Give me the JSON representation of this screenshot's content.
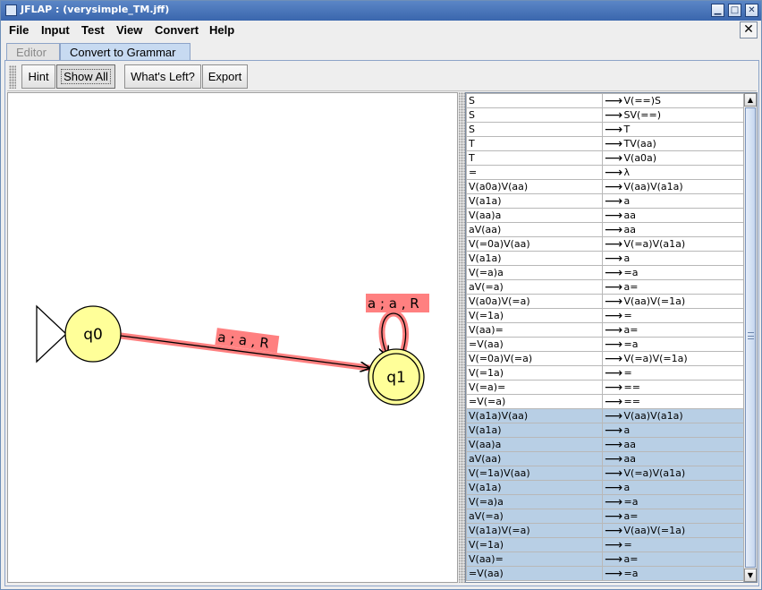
{
  "window": {
    "title": "JFLAP : (verysimple_TM.jff)"
  },
  "menu": [
    "File",
    "Input",
    "Test",
    "View",
    "Convert",
    "Help"
  ],
  "tabs": {
    "editor": "Editor",
    "convert": "Convert to Grammar"
  },
  "toolbar": {
    "hint": "Hint",
    "show_all": "Show All",
    "whats_left": "What's Left?",
    "export": "Export"
  },
  "automaton": {
    "states": [
      {
        "name": "q0",
        "initial": true,
        "final": false
      },
      {
        "name": "q1",
        "initial": false,
        "final": true
      }
    ],
    "transitions": [
      {
        "from": "q0",
        "to": "q1",
        "label": "a ; a , R"
      },
      {
        "from": "q1",
        "to": "q1",
        "label": "a ; a , R"
      }
    ],
    "state_fill": "#ffff99",
    "highlight_color": "#ff8080"
  },
  "grammar": {
    "arrow": "⟶",
    "selected_color": "#b8cfe5",
    "productions": [
      {
        "lhs": "S",
        "rhs": "V(==)S",
        "selected": false
      },
      {
        "lhs": "S",
        "rhs": "SV(==)",
        "selected": false
      },
      {
        "lhs": "S",
        "rhs": "T",
        "selected": false
      },
      {
        "lhs": "T",
        "rhs": "TV(aa)",
        "selected": false
      },
      {
        "lhs": "T",
        "rhs": "V(a0a)",
        "selected": false
      },
      {
        "lhs": "=",
        "rhs": "λ",
        "selected": false
      },
      {
        "lhs": "V(a0a)V(aa)",
        "rhs": "V(aa)V(a1a)",
        "selected": false
      },
      {
        "lhs": "V(a1a)",
        "rhs": "a",
        "selected": false
      },
      {
        "lhs": "V(aa)a",
        "rhs": "aa",
        "selected": false
      },
      {
        "lhs": "aV(aa)",
        "rhs": "aa",
        "selected": false
      },
      {
        "lhs": "V(=0a)V(aa)",
        "rhs": "V(=a)V(a1a)",
        "selected": false
      },
      {
        "lhs": "V(a1a)",
        "rhs": "a",
        "selected": false
      },
      {
        "lhs": "V(=a)a",
        "rhs": "=a",
        "selected": false
      },
      {
        "lhs": "aV(=a)",
        "rhs": "a=",
        "selected": false
      },
      {
        "lhs": "V(a0a)V(=a)",
        "rhs": "V(aa)V(=1a)",
        "selected": false
      },
      {
        "lhs": "V(=1a)",
        "rhs": "=",
        "selected": false
      },
      {
        "lhs": "V(aa)=",
        "rhs": "a=",
        "selected": false
      },
      {
        "lhs": "=V(aa)",
        "rhs": "=a",
        "selected": false
      },
      {
        "lhs": "V(=0a)V(=a)",
        "rhs": "V(=a)V(=1a)",
        "selected": false
      },
      {
        "lhs": "V(=1a)",
        "rhs": "=",
        "selected": false
      },
      {
        "lhs": "V(=a)=",
        "rhs": "==",
        "selected": false
      },
      {
        "lhs": "=V(=a)",
        "rhs": "==",
        "selected": false
      },
      {
        "lhs": "V(a1a)V(aa)",
        "rhs": "V(aa)V(a1a)",
        "selected": true
      },
      {
        "lhs": "V(a1a)",
        "rhs": "a",
        "selected": true
      },
      {
        "lhs": "V(aa)a",
        "rhs": "aa",
        "selected": true
      },
      {
        "lhs": "aV(aa)",
        "rhs": "aa",
        "selected": true
      },
      {
        "lhs": "V(=1a)V(aa)",
        "rhs": "V(=a)V(a1a)",
        "selected": true
      },
      {
        "lhs": "V(a1a)",
        "rhs": "a",
        "selected": true
      },
      {
        "lhs": "V(=a)a",
        "rhs": "=a",
        "selected": true
      },
      {
        "lhs": "aV(=a)",
        "rhs": "a=",
        "selected": true
      },
      {
        "lhs": "V(a1a)V(=a)",
        "rhs": "V(aa)V(=1a)",
        "selected": true
      },
      {
        "lhs": "V(=1a)",
        "rhs": "=",
        "selected": true
      },
      {
        "lhs": "V(aa)=",
        "rhs": "a=",
        "selected": true
      },
      {
        "lhs": "=V(aa)",
        "rhs": "=a",
        "selected": true
      }
    ]
  }
}
